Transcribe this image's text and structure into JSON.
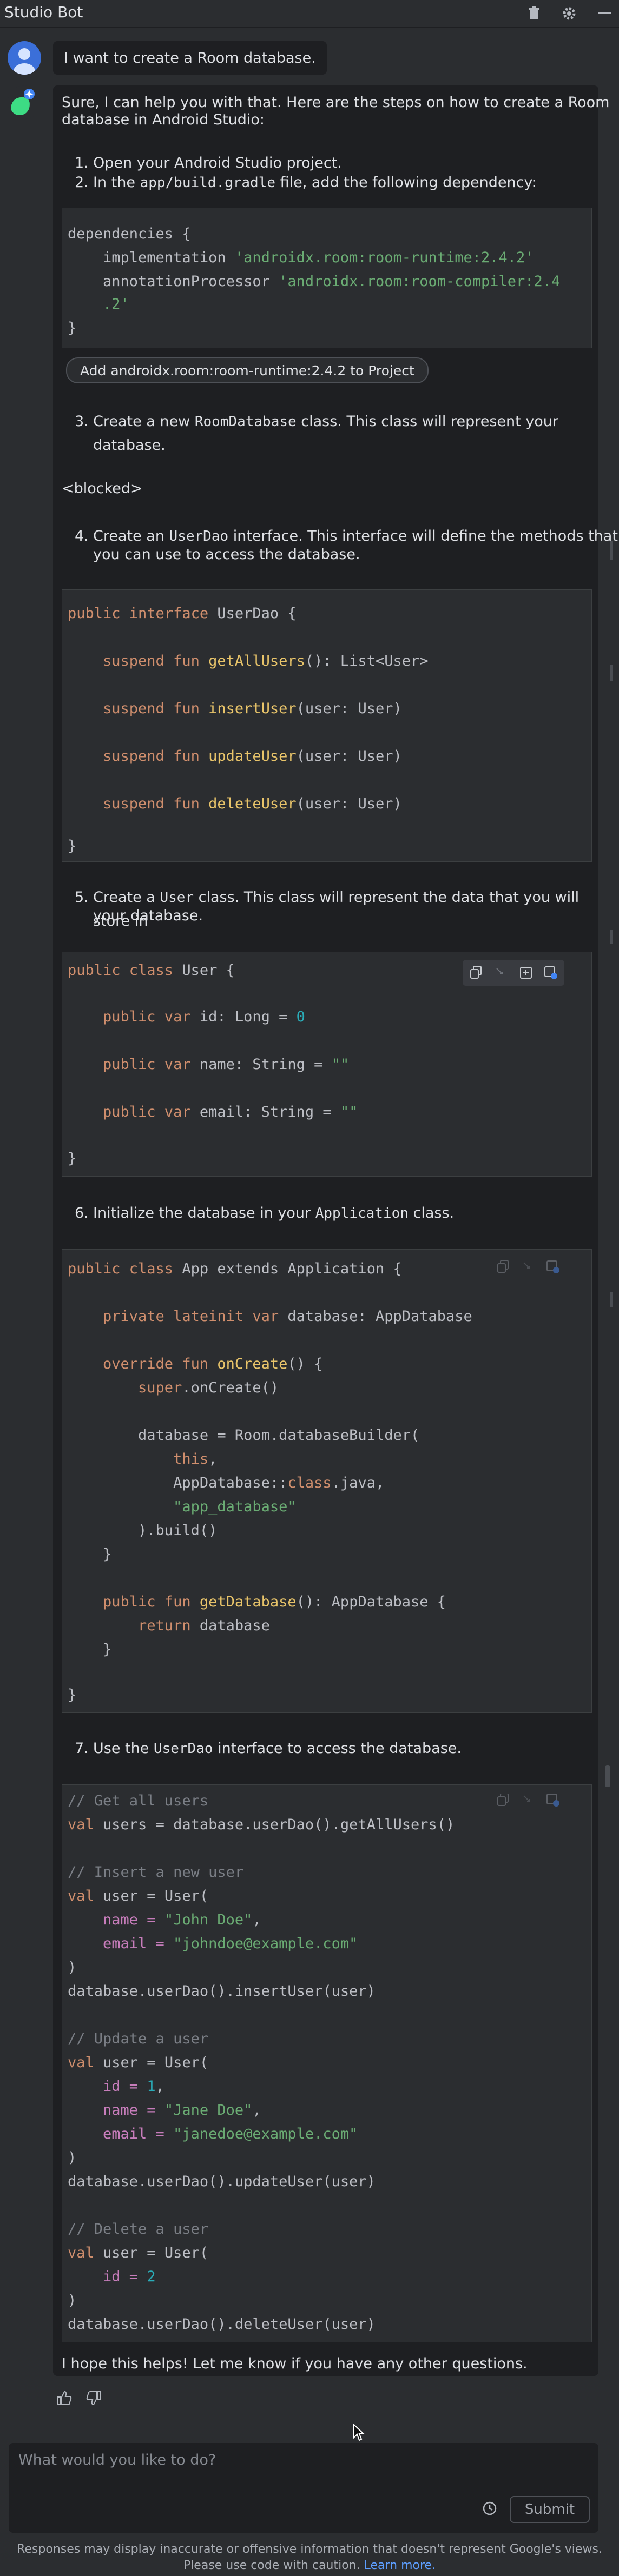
{
  "app": {
    "title": "Studio Bot"
  },
  "header_icons": [
    "trash-icon",
    "gear-icon",
    "minimize-icon"
  ],
  "user_message": "I want to create a Room database.",
  "bot": {
    "intro_line1": "Sure, I can help you with that. Here are the steps on how to create a Room",
    "intro_line2": "database in Android Studio:",
    "step1": "Open your Android Studio project.",
    "step2_a": "In the ",
    "step2_code": "app/build.gradle",
    "step2_b": " file, add the following dependency:",
    "dep_code": {
      "l1": "dependencies {",
      "l2_a": "    implementation ",
      "l2_b": "'androidx.room:room-runtime:2.4.2'",
      "l3_a": "    annotationProcessor ",
      "l3_b": "'androidx.room:room-compiler:2.4",
      "l4": "    .2'",
      "l5": "}"
    },
    "add_button": "Add androidx.room:room-runtime:2.4.2 to Project",
    "step3_a": "Create a new ",
    "step3_code": "RoomDatabase",
    "step3_b": " class. This class will represent your database.",
    "blocked": "<blocked>",
    "step4_a": "Create an ",
    "step4_code": "UserDao",
    "step4_b": " interface. This interface will define the methods that",
    "step4_c": "you can use to access the database.",
    "dao_code": {
      "l1_a": "public interface ",
      "l1_b": "UserDao {",
      "l2_a": "    suspend fun ",
      "l2_b": "getAllUsers",
      "l2_c": "(): List<User>",
      "l3_a": "    suspend fun ",
      "l3_b": "insertUser",
      "l3_c": "(user: User)",
      "l4_a": "    suspend fun ",
      "l4_b": "updateUser",
      "l4_c": "(user: User)",
      "l5_a": "    suspend fun ",
      "l5_b": "deleteUser",
      "l5_c": "(user: User)",
      "l6": "}"
    },
    "step5_a": "Create a ",
    "step5_code": "User",
    "step5_b": " class. This class will represent the data that you will store in",
    "step5_c": "your database.",
    "user_code": {
      "l1_a": "public class ",
      "l1_b": "User {",
      "l2_a": "    public var ",
      "l2_b": "id: Long = ",
      "l2_c": "0",
      "l3_a": "    public var ",
      "l3_b": "name: String = ",
      "l3_c": "\"\"",
      "l4_a": "    public var ",
      "l4_b": "email: String = ",
      "l4_c": "\"\"",
      "l5": "}"
    },
    "step6_a": "Initialize the database in your ",
    "step6_code": "Application",
    "step6_b": " class.",
    "app_code": {
      "l1_a": "public class ",
      "l1_b": "App extends Application {",
      "l2_a": "    private lateinit var ",
      "l2_b": "database: AppDatabase",
      "l3_a": "    override fun ",
      "l3_b": "onCreate",
      "l3_c": "() {",
      "l4_a": "        super",
      "l4_b": ".onCreate()",
      "l5": "        database = Room.databaseBuilder(",
      "l6_a": "            this",
      "l6_b": ",",
      "l7_a": "            AppDatabase::",
      "l7_b": "class",
      "l7_c": ".java,",
      "l8": "            \"app_database\"",
      "l9": "        ).build()",
      "l10": "    }",
      "l11_a": "    public fun ",
      "l11_b": "getDatabase",
      "l11_c": "(): AppDatabase {",
      "l12_a": "        return ",
      "l12_b": "database",
      "l13": "    }",
      "l14": "}"
    },
    "step7_a": "Use the ",
    "step7_code": "UserDao",
    "step7_b": " interface to access the database.",
    "usage_code": {
      "l1": "// Get all users",
      "l2_a": "val ",
      "l2_b": "users = database.userDao().getAllUsers()",
      "l3": "// Insert a new user",
      "l4_a": "val ",
      "l4_b": "user = User(",
      "l5_a": "    name = ",
      "l5_b": "\"John Doe\"",
      "l5_c": ",",
      "l6_a": "    email = ",
      "l6_b": "\"johndoe@example.com\"",
      "l7": ")",
      "l8": "database.userDao().insertUser(user)",
      "l9": "// Update a user",
      "l10_a": "val ",
      "l10_b": "user = User(",
      "l11_a": "    id = ",
      "l11_b": "1",
      "l11_c": ",",
      "l12_a": "    name = ",
      "l12_b": "\"Jane Doe\"",
      "l12_c": ",",
      "l13_a": "    email = ",
      "l13_b": "\"janedoe@example.com\"",
      "l14": ")",
      "l15": "database.userDao().updateUser(user)",
      "l16": "// Delete a user",
      "l17_a": "val ",
      "l17_b": "user = User(",
      "l18_a": "    id = ",
      "l18_b": "2",
      "l19": ")",
      "l20": "database.userDao().deleteUser(user)"
    },
    "outro": "I hope this helps! Let me know if you have any other questions."
  },
  "code_toolbar_icons": [
    "copy-icon",
    "insert-at-cursor-icon",
    "new-file-icon",
    "explain-icon"
  ],
  "feedback": [
    "thumbs-up-icon",
    "thumbs-down-icon"
  ],
  "input": {
    "placeholder": "What would you like to do?",
    "submit": "Submit"
  },
  "disclaimer": {
    "line1": "Responses may display inaccurate or offensive information that doesn't represent Google's views.",
    "line2": "Please use code with caution. ",
    "link": "Learn more."
  },
  "colors": {
    "background": "#2b2d30",
    "panel": "#1e1f22",
    "keyword": "#cf8e6d",
    "function": "#56a8f5",
    "string": "#6aab73",
    "number": "#2aacb8",
    "link": "#5d9eff"
  }
}
